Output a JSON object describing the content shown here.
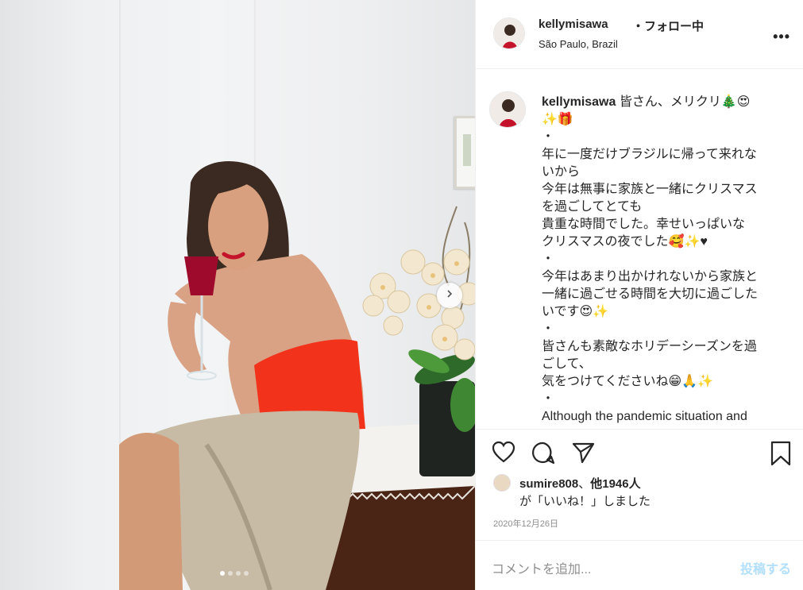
{
  "post": {
    "username": "kellymisawa",
    "follow_status": "フォロー中",
    "location": "São Paulo, Brazil",
    "more_label": "•••",
    "caption_lines": [
      "皆さん、メリクリ🎄😍",
      "✨🎁",
      "・",
      "年に一度だけブラジルに帰って来れな",
      "いから",
      "今年は無事に家族と一緒にクリスマス",
      "を過ごしてとても",
      "貴重な時間でした。幸せいっぱいな",
      "クリスマスの夜でした🥰✨♥",
      "・",
      "今年はあまり出かけれないから家族と",
      "一緒に過ごせる時間を大切に過ごした",
      "いです😍✨",
      "・",
      "皆さんも素敵なホリデーシーズンを過",
      "ごして、",
      "気をつけてくださいね😁🙏✨",
      "・",
      "Although the pandemic situation and"
    ],
    "likes": {
      "liker": "sumire808",
      "others": "他1946人",
      "suffix": "が「いいね！」しました"
    },
    "date": "2020年12月26日",
    "comment_placeholder": "コメントを追加...",
    "post_button": "投稿する",
    "carousel": {
      "total": 4,
      "active_index": 0
    }
  },
  "icons": {
    "like": "heart-icon",
    "comment": "comment-icon",
    "share": "paper-plane-icon",
    "save": "bookmark-icon",
    "next": "chevron-right-icon"
  },
  "colors": {
    "text": "#262626",
    "muted": "#8e8e8e",
    "post_button": "#b2dffc",
    "border": "#efefef"
  }
}
